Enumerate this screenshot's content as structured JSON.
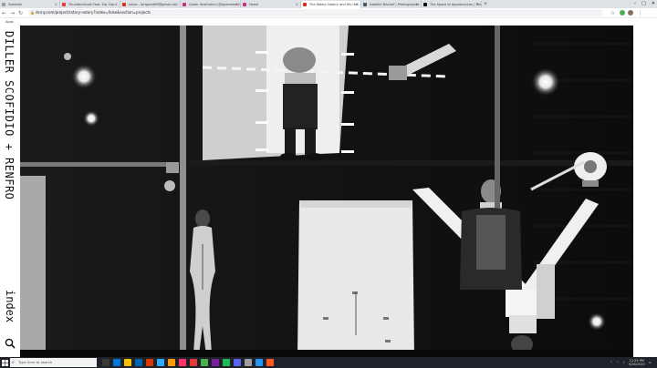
{
  "browser": {
    "tabs": [
      {
        "label": "Seabirds",
        "color": "#9aa0a6",
        "active": false
      },
      {
        "label": "Thunderclouds Feat. Sia, Dip...",
        "color": "#e53935",
        "active": false
      },
      {
        "label": "Inbox - lorigould89@gmail.co...",
        "color": "#d93025",
        "active": false
      },
      {
        "label": "Queer Aesthetics (@queeraesth...",
        "color": "#c13584",
        "active": false
      },
      {
        "label": "Home",
        "color": "#c13584",
        "active": false
      },
      {
        "label": "The Rotary Notary and His Hot...",
        "color": "#d93025",
        "active": true
      },
      {
        "label": "Isabelle Bischof | Photographer",
        "color": "#455a64",
        "active": false
      },
      {
        "label": "The Space of Appearances | The...",
        "color": "#111111",
        "active": false
      }
    ],
    "url": "dsrny.com/project/rotary-notary?index=false&section=projects",
    "bookmark": "Apps"
  },
  "site": {
    "firm_name": "DILLER SCOFIDIO + RENFRO",
    "index_label": "index"
  },
  "taskbar": {
    "search_placeholder": "Type here to search",
    "time": "12:25 PM",
    "date": "5/26/2020"
  },
  "colors": {
    "taskbar_bg": "#1f2228",
    "windows_blue": "#00a4ef",
    "page_bg": "#ffffff",
    "photo_bg": "#121212"
  },
  "icons": {
    "site_search": "search-icon",
    "windows_start": "windows-logo-icon",
    "taskbar_search": "search-icon"
  }
}
